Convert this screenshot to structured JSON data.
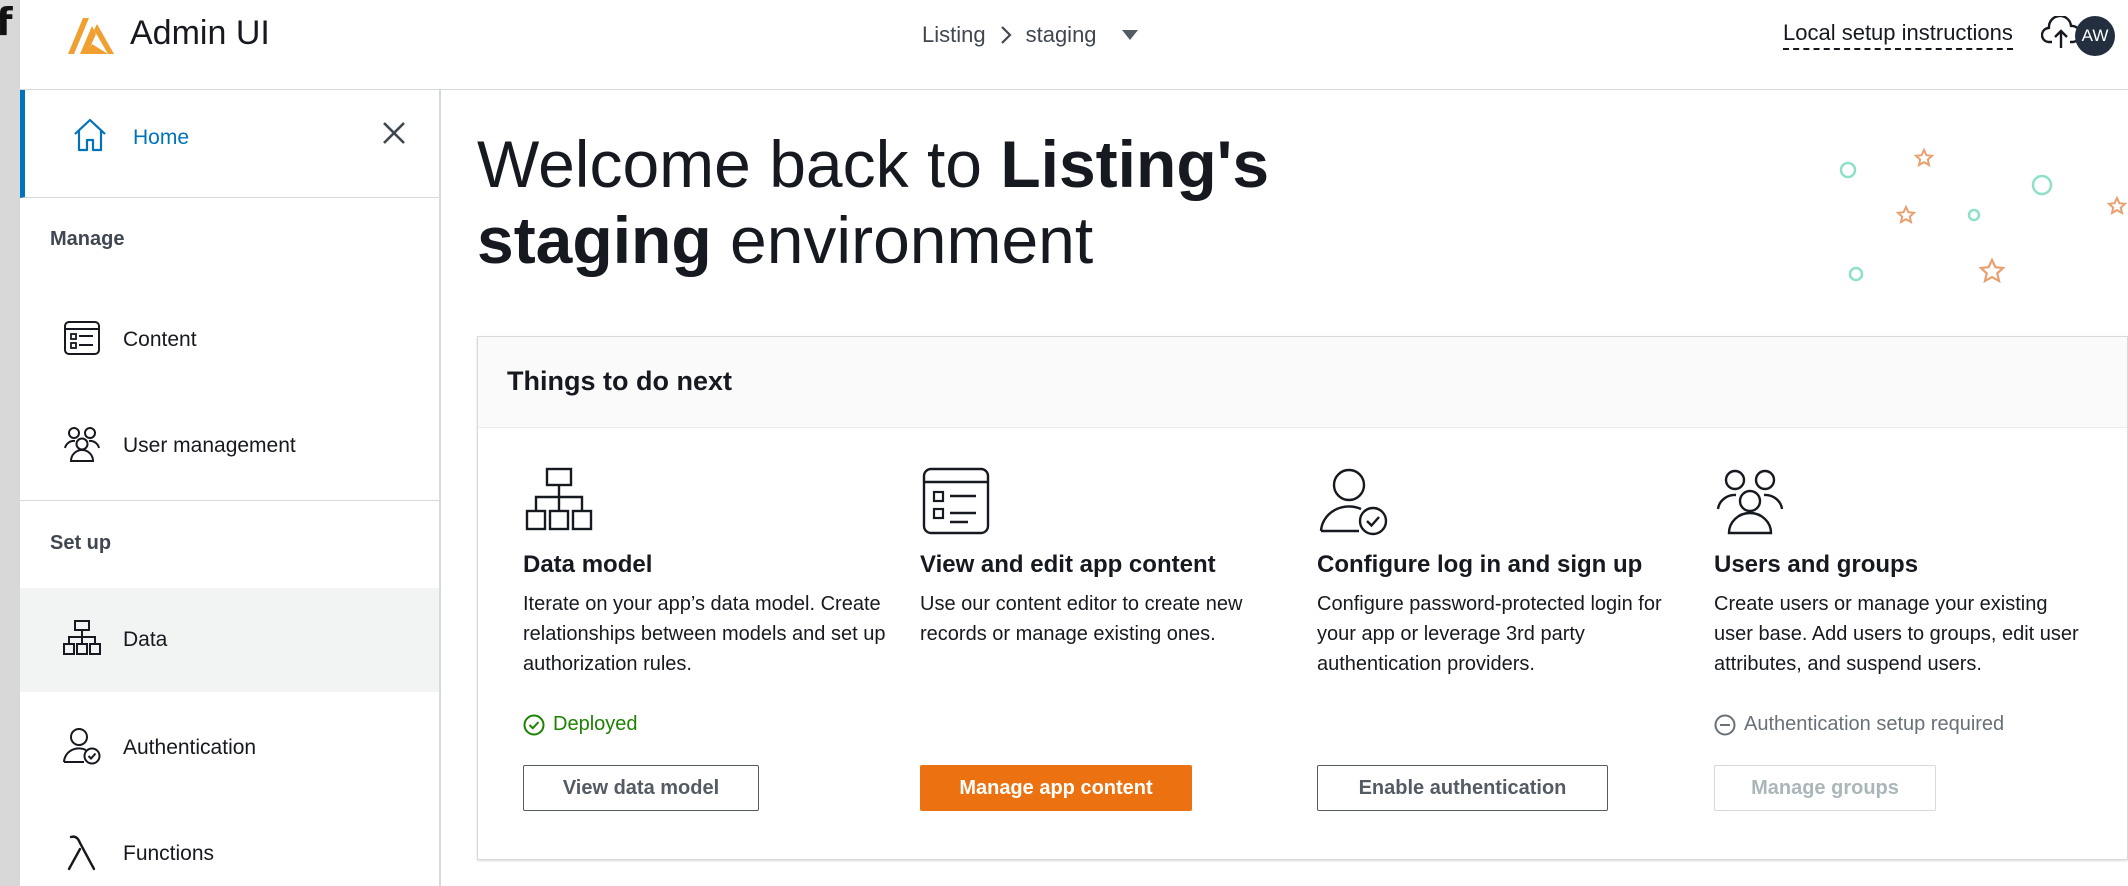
{
  "colors": {
    "accent": "#0073bb",
    "primary_button": "#ec7211",
    "success": "#1d8102",
    "muted": "#687078",
    "logo": "#f0a030",
    "deco_circle": "#8ee0c8",
    "deco_star": "#e8a070"
  },
  "topbar": {
    "partial_left_glyph": "f",
    "logo_icon": "amplify-logo-icon",
    "app_title": "Admin UI",
    "breadcrumb": {
      "first": "Listing",
      "second": "staging"
    },
    "setup_link": "Local setup instructions",
    "cloud_icon": "cloud-upload-icon",
    "avatar_initials": "AW"
  },
  "sidebar": {
    "home": {
      "label": "Home",
      "icon": "home-icon"
    },
    "close_icon": "close-icon",
    "manage_heading": "Manage",
    "manage_items": [
      {
        "label": "Content",
        "icon": "content-list-icon"
      },
      {
        "label": "User management",
        "icon": "users-icon"
      }
    ],
    "setup_heading": "Set up",
    "setup_items": [
      {
        "label": "Data",
        "icon": "data-model-icon",
        "active": true
      },
      {
        "label": "Authentication",
        "icon": "user-check-icon"
      },
      {
        "label": "Functions",
        "icon": "lambda-icon"
      }
    ]
  },
  "main": {
    "welcome": {
      "prefix": "Welcome back to ",
      "app": "Listing's",
      "env": "staging",
      "suffix": " environment"
    },
    "card": {
      "title": "Things to do next",
      "items": [
        {
          "icon": "data-model-icon",
          "title": "Data model",
          "description": "Iterate on your app’s data model. Create relationships between models and set up authorization rules.",
          "status": "Deployed",
          "status_icon": "check-circle-icon",
          "button": "View data model"
        },
        {
          "icon": "content-list-icon",
          "title": "View and edit app content",
          "description": "Use our content editor to create new records or manage existing ones.",
          "button": "Manage app content"
        },
        {
          "icon": "user-check-icon",
          "title": "Configure log in and sign up",
          "description": "Configure password-protected login for your app or leverage 3rd party authentication providers.",
          "button": "Enable authentication"
        },
        {
          "icon": "users-icon",
          "title": "Users and groups",
          "description": "Create users or manage your existing user base. Add users to groups, edit user attributes, and suspend users.",
          "status": "Authentication setup required",
          "status_icon": "minus-circle-icon",
          "button": "Manage groups"
        }
      ]
    }
  }
}
